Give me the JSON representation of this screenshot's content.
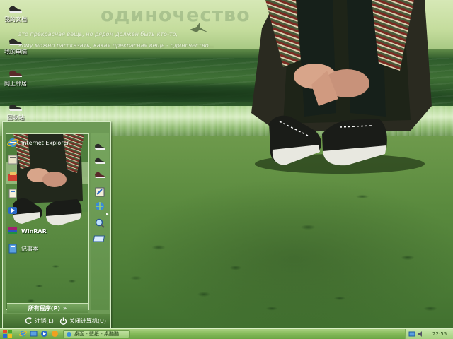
{
  "wallpaper": {
    "title": "одиночество",
    "line1": "это прекрасная вещь, но рядом должен быть кто-то,",
    "line2": "кому можно рассказать, какая прекрасная вещь - одиночество..."
  },
  "desktop_icons": [
    {
      "label": "我的文档",
      "icon": "sneaker-icon"
    },
    {
      "label": "我的电脑",
      "icon": "sneaker-icon"
    },
    {
      "label": "网上邻居",
      "icon": "sneaker-icon"
    },
    {
      "label": "回收站",
      "icon": "sneaker-icon"
    }
  ],
  "start_menu": {
    "pinned": [
      {
        "label": "Internet Explorer",
        "icon": "internet-explorer-icon"
      },
      {
        "label": "",
        "icon": "notepad-folder-icon"
      },
      {
        "label": "",
        "icon": "paint-icon"
      },
      {
        "label": "",
        "icon": "files-icon"
      },
      {
        "label": "",
        "icon": "media-icon"
      },
      {
        "label": "WinRAR",
        "icon": "winrar-icon"
      },
      {
        "label": "记事本",
        "icon": "notepad-icon"
      }
    ],
    "all_programs": "所有程序(P)",
    "all_programs_arrow": "»",
    "right_icons": [
      "sneaker-icon",
      "sneaker-icon",
      "sneaker-icon",
      "control-panel-icon",
      "network-icon",
      "search-icon",
      "run-icon"
    ],
    "right_arrow": "▸",
    "logoff": "注销(L)",
    "shutdown": "关闭计算机(U)"
  },
  "taskbar": {
    "task": "桌面 - 壁纸 - 桌酷酷",
    "clock": "22:55"
  },
  "colors": {
    "accent": "#6d9a56",
    "taskbar": "#86bb5a",
    "menu_border": "#d7ecc6"
  }
}
